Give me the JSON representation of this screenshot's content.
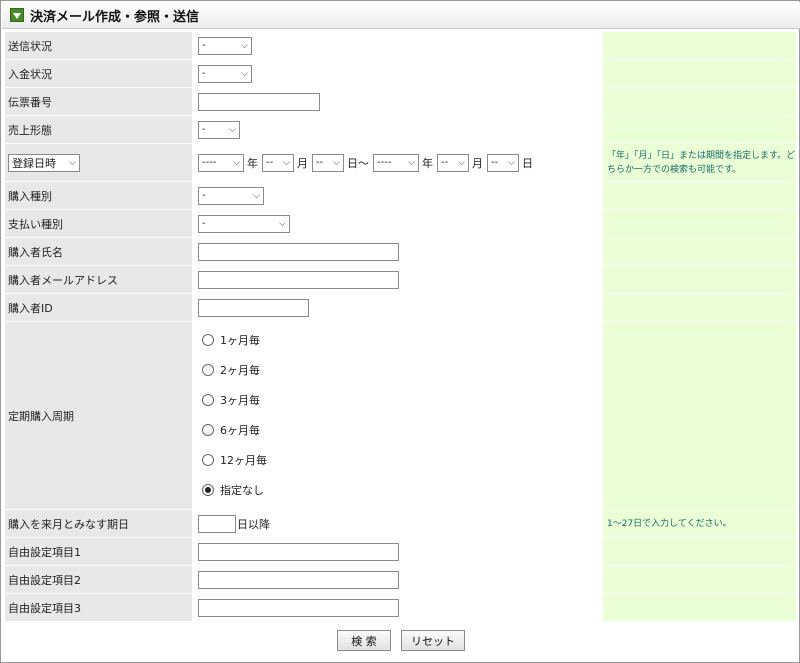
{
  "title": "決済メール作成・参照・送信",
  "rows": {
    "send_status": {
      "label": "送信状況",
      "value": "-"
    },
    "payment_status": {
      "label": "入金状況",
      "value": "-"
    },
    "slip_number": {
      "label": "伝票番号",
      "value": ""
    },
    "sales_type": {
      "label": "売上形態",
      "value": "-"
    },
    "date_row": {
      "label_select": "登録日時",
      "year_from": "----",
      "year_unit": "年",
      "month_from": "--",
      "month_unit": "月",
      "day_from": "--",
      "day_unit_from": "日〜",
      "year_to": "----",
      "year_unit_to": "年",
      "month_to": "--",
      "month_unit_to": "月",
      "day_to": "--",
      "day_unit_to": "日",
      "note": "「年」「月」「日」または期間を指定します。どちらか一方での検索も可能です。"
    },
    "purchase_type": {
      "label": "購入種別",
      "value": "-"
    },
    "payment_type": {
      "label": "支払い種別",
      "value": "-"
    },
    "buyer_name": {
      "label": "購入者氏名",
      "value": ""
    },
    "buyer_email": {
      "label": "購入者メールアドレス",
      "value": ""
    },
    "buyer_id": {
      "label": "購入者ID",
      "value": ""
    },
    "cycle": {
      "label": "定期購入周期",
      "options": [
        "1ヶ月毎",
        "2ヶ月毎",
        "3ヶ月毎",
        "6ヶ月毎",
        "12ヶ月毎",
        "指定なし"
      ],
      "selected": "指定なし"
    },
    "next_month_day": {
      "label": "購入を来月とみなす期日",
      "value": "",
      "suffix": "日以降",
      "note": "1〜27日で入力してください。"
    },
    "free1": {
      "label": "自由設定項目1",
      "value": ""
    },
    "free2": {
      "label": "自由設定項目2",
      "value": ""
    },
    "free3": {
      "label": "自由設定項目3",
      "value": ""
    }
  },
  "buttons": {
    "search": "検 索",
    "reset": "リセット"
  },
  "icons": {
    "title": "triangle-down-icon",
    "select": "chevron-down-icon"
  },
  "colors": {
    "label_bg": "#e8e8e8",
    "note_bg": "#eaffd6",
    "note_text": "#1a6a6a",
    "title_icon": "#4a8a2a"
  }
}
